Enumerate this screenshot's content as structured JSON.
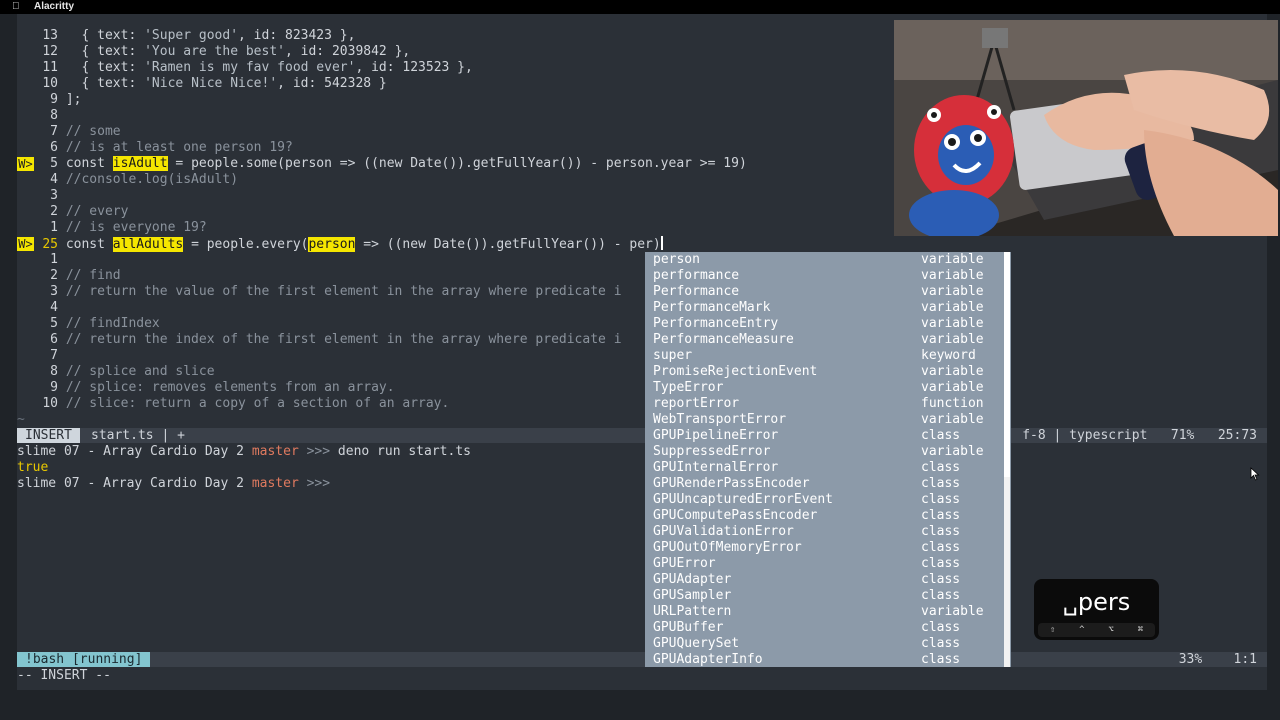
{
  "menubar": {
    "apple_icon": "",
    "app_name": "Alacritty"
  },
  "editor": {
    "lines": [
      {
        "num": "13",
        "parts": [
          {
            "t": "  { text: "
          },
          {
            "t": "'Super good'",
            "c": "str"
          },
          {
            "t": ", id: 823423 },"
          }
        ]
      },
      {
        "num": "12",
        "parts": [
          {
            "t": "  { text: "
          },
          {
            "t": "'You are the best'",
            "c": "str"
          },
          {
            "t": ", id: 2039842 },"
          }
        ]
      },
      {
        "num": "11",
        "parts": [
          {
            "t": "  { text: "
          },
          {
            "t": "'Ramen is my fav food ever'",
            "c": "str"
          },
          {
            "t": ", id: 123523 },"
          }
        ]
      },
      {
        "num": "10",
        "parts": [
          {
            "t": "  { text: "
          },
          {
            "t": "'Nice Nice Nice!'",
            "c": "str"
          },
          {
            "t": ", id: 542328 }"
          }
        ]
      },
      {
        "num": "9",
        "parts": [
          {
            "t": "];"
          }
        ]
      },
      {
        "num": "8",
        "parts": []
      },
      {
        "num": "7",
        "parts": [
          {
            "t": "// some",
            "c": "cm"
          }
        ]
      },
      {
        "num": "6",
        "parts": [
          {
            "t": "// is at least one person 19?",
            "c": "cm"
          }
        ]
      },
      {
        "num": "5",
        "tag": "W>",
        "parts": [
          {
            "t": "const "
          },
          {
            "t": "isAdult",
            "c": "hl"
          },
          {
            "t": " = people.some(person => ((new Date()).getFullYear()) - person.year >= 19)"
          }
        ]
      },
      {
        "num": "4",
        "parts": [
          {
            "t": "//console.log(isAdult)",
            "c": "cm"
          }
        ]
      },
      {
        "num": "3",
        "parts": []
      },
      {
        "num": "2",
        "parts": [
          {
            "t": "// every",
            "c": "cm"
          }
        ]
      },
      {
        "num": "1",
        "parts": [
          {
            "t": "// is everyone 19?",
            "c": "cm"
          }
        ]
      },
      {
        "num": "25",
        "tag": "W>",
        "current": true,
        "parts": [
          {
            "t": "const "
          },
          {
            "t": "allAdults",
            "c": "hl"
          },
          {
            "t": " = people.every("
          },
          {
            "t": "person",
            "c": "hl2"
          },
          {
            "t": " => ((new Date()).getFullYear()) - per"
          },
          {
            "t": ")",
            "c": "cursor"
          }
        ]
      },
      {
        "num": "1",
        "parts": []
      },
      {
        "num": "2",
        "parts": [
          {
            "t": "// find",
            "c": "cm"
          }
        ]
      },
      {
        "num": "3",
        "parts": [
          {
            "t": "// return the value of the first element in the array where predicate i",
            "c": "cm"
          }
        ]
      },
      {
        "num": "4",
        "parts": []
      },
      {
        "num": "5",
        "parts": [
          {
            "t": "// findIndex",
            "c": "cm"
          }
        ]
      },
      {
        "num": "6",
        "parts": [
          {
            "t": "// return the index of the first element in the array where predicate i",
            "c": "cm"
          }
        ]
      },
      {
        "num": "7",
        "parts": []
      },
      {
        "num": "8",
        "parts": [
          {
            "t": "// splice and slice",
            "c": "cm"
          }
        ]
      },
      {
        "num": "9",
        "parts": [
          {
            "t": "// splice: removes elements from an array.",
            "c": "cm"
          }
        ]
      },
      {
        "num": "10",
        "parts": [
          {
            "t": "// slice: return a copy of a section of an array.",
            "c": "cm"
          }
        ]
      }
    ],
    "tilde": "~"
  },
  "statusline": {
    "mode": "INSERT",
    "file": "start.ts | +",
    "right": "f-8 | typescript   71%   25:73"
  },
  "shell": {
    "line1_prefix": "slime 07 - Array Cardio Day 2 ",
    "branch": "master",
    "sep": " >>>",
    "line1_cmd": " deno run start.ts",
    "output": "true",
    "line3_prefix": "slime 07 - Array Cardio Day 2 "
  },
  "bash_status": {
    "tag": "!bash [running]",
    "right": "33%    1:1"
  },
  "insert_mode_line": "-- INSERT --",
  "completion": [
    {
      "label": "person",
      "kind": "variable"
    },
    {
      "label": "performance",
      "kind": "variable"
    },
    {
      "label": "Performance",
      "kind": "variable"
    },
    {
      "label": "PerformanceMark",
      "kind": "variable"
    },
    {
      "label": "PerformanceEntry",
      "kind": "variable"
    },
    {
      "label": "PerformanceMeasure",
      "kind": "variable"
    },
    {
      "label": "super",
      "kind": "keyword"
    },
    {
      "label": "PromiseRejectionEvent",
      "kind": "variable"
    },
    {
      "label": "TypeError",
      "kind": "variable"
    },
    {
      "label": "reportError",
      "kind": "function"
    },
    {
      "label": "WebTransportError",
      "kind": "variable"
    },
    {
      "label": "GPUPipelineError",
      "kind": "class"
    },
    {
      "label": "SuppressedError",
      "kind": "variable"
    },
    {
      "label": "GPUInternalError",
      "kind": "class"
    },
    {
      "label": "GPURenderPassEncoder",
      "kind": "class"
    },
    {
      "label": "GPUUncapturedErrorEvent",
      "kind": "class"
    },
    {
      "label": "GPUComputePassEncoder",
      "kind": "class"
    },
    {
      "label": "GPUValidationError",
      "kind": "class"
    },
    {
      "label": "GPUOutOfMemoryError",
      "kind": "class"
    },
    {
      "label": "GPUError",
      "kind": "class"
    },
    {
      "label": "GPUAdapter",
      "kind": "class"
    },
    {
      "label": "GPUSampler",
      "kind": "class"
    },
    {
      "label": "URLPattern",
      "kind": "variable"
    },
    {
      "label": "GPUBuffer",
      "kind": "class"
    },
    {
      "label": "GPUQuerySet",
      "kind": "class"
    },
    {
      "label": "GPUAdapterInfo",
      "kind": "class"
    }
  ],
  "key_hud": {
    "text": "␣pers",
    "mods": [
      "⇧",
      "^",
      "⌥",
      "⌘"
    ]
  },
  "colors": {
    "highlight": "#f5e600",
    "branch": "#e07a5f",
    "popup_bg": "#8c9aa9",
    "bash_tag": "#83c5cf"
  }
}
